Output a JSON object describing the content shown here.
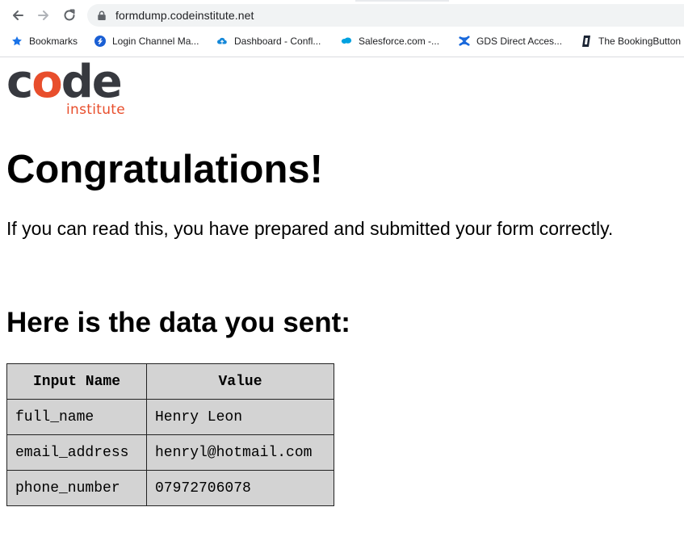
{
  "browser": {
    "url": "formdump.codeinstitute.net",
    "bookmarks": [
      {
        "label": "Bookmarks",
        "icon": "star-icon"
      },
      {
        "label": "Login Channel Ma...",
        "icon": "channel-logo-icon"
      },
      {
        "label": "Dashboard - Confl...",
        "icon": "cloud-icon"
      },
      {
        "label": "Salesforce.com -...",
        "icon": "salesforce-icon"
      },
      {
        "label": "GDS Direct Acces...",
        "icon": "confluence-icon"
      },
      {
        "label": "The BookingButton",
        "icon": "bookingbutton-icon"
      }
    ]
  },
  "logo": {
    "word": "code",
    "sub": "institute",
    "accent_color": "#e84e2c",
    "dark_color": "#37393f"
  },
  "page": {
    "heading": "Congratulations!",
    "message": "If you can read this, you have prepared and submitted your form correctly.",
    "subheading": "Here is the data you sent:"
  },
  "table": {
    "headers": [
      "Input Name",
      "Value"
    ],
    "rows": [
      [
        "full_name",
        "Henry Leon"
      ],
      [
        "email_address",
        "henryl@hotmail.com"
      ],
      [
        "phone_number",
        "07972706078"
      ]
    ]
  }
}
